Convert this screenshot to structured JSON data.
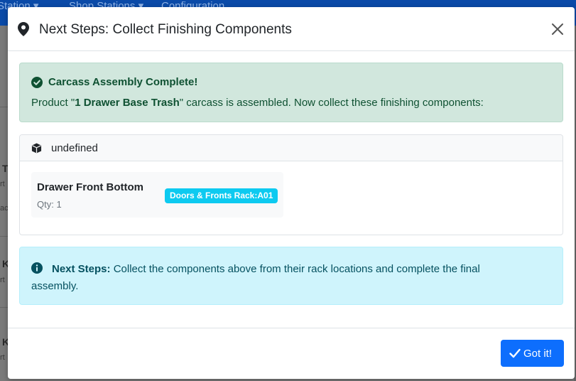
{
  "background": {
    "nav_items": [
      "Station ▾",
      "Shop Stations ▾",
      "Configuration"
    ],
    "fragments": [
      "T",
      "rt",
      "ac",
      "K",
      "rt",
      "K",
      "rt"
    ]
  },
  "modal": {
    "title": "Next Steps: Collect Finishing Components",
    "close_label": "×",
    "icons": {
      "title_icon": "map-marker-icon",
      "close_icon": "close-icon",
      "success_icon": "check-circle-icon",
      "section_icon": "cube-icon",
      "info_icon": "info-circle-icon",
      "button_icon": "check-icon"
    },
    "success_alert": {
      "title": "Carcass Assembly Complete!",
      "message_prefix": "Product \"",
      "product_name": "1 Drawer Base Trash",
      "message_suffix": "\" carcass is assembled. Now collect these finishing components:"
    },
    "components_card": {
      "title": "undefined",
      "items": [
        {
          "name": "Drawer Front Bottom",
          "qty": "Qty: 1",
          "rack_location": "Doors & Fronts Rack:A01"
        }
      ]
    },
    "info_alert": {
      "label": "Next Steps:",
      "text": " Collect the components above from their rack locations and complete the final assembly."
    },
    "footer": {
      "button_label": "Got it!"
    }
  },
  "colors": {
    "primary": "#0d6efd",
    "success_bg": "#d1e7dd",
    "success_text": "#0f5132",
    "info_bg": "#cff4fc",
    "info_text": "#055160",
    "badge": "#0dcaf0",
    "navbar": "#0a4aa8"
  }
}
